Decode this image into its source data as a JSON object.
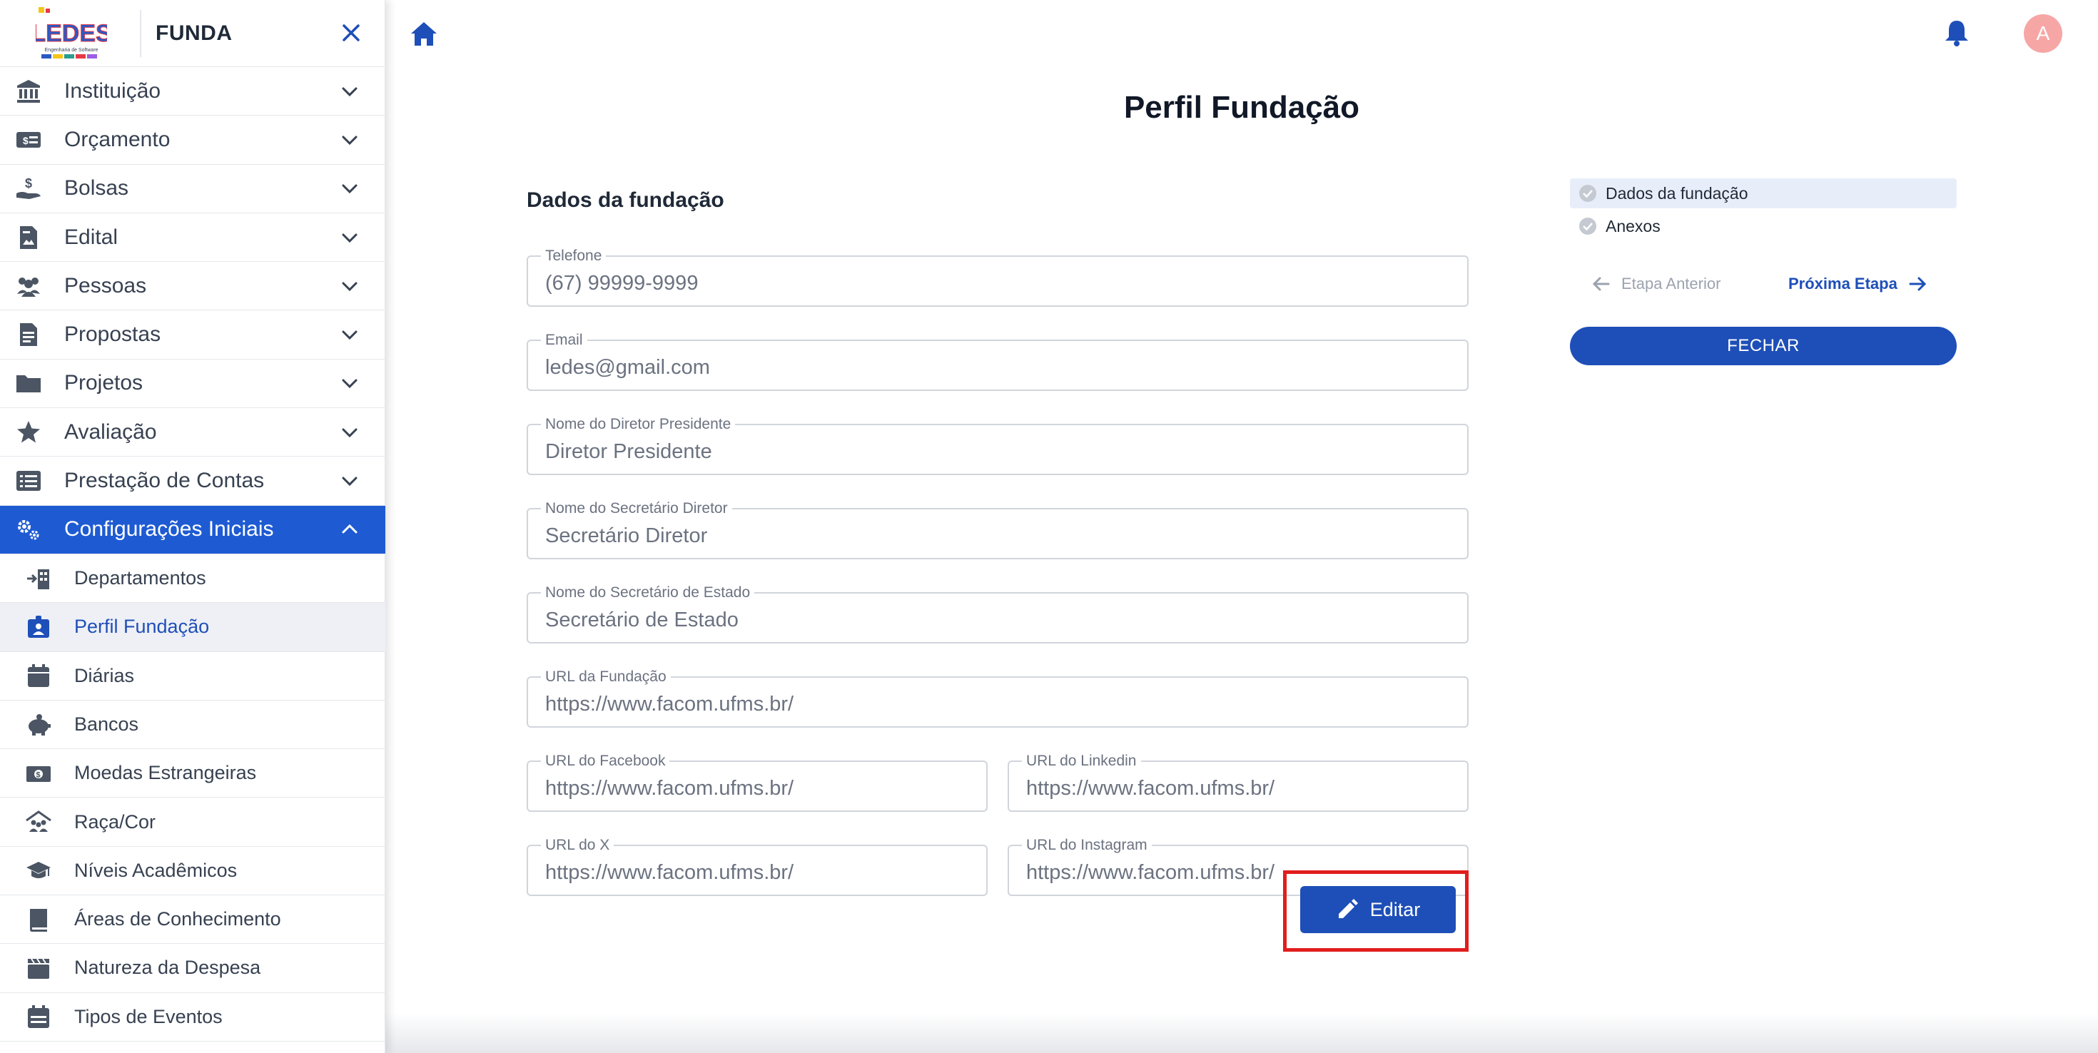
{
  "app": {
    "name": "FUNDA",
    "logo_text": "LEDES",
    "logo_subtext": "Engenharia de Software"
  },
  "sidebar": {
    "items": [
      {
        "label": "Instituição",
        "icon": "bank-icon"
      },
      {
        "label": "Orçamento",
        "icon": "money-icon"
      },
      {
        "label": "Bolsas",
        "icon": "hand-coin-icon"
      },
      {
        "label": "Edital",
        "icon": "document-image-icon"
      },
      {
        "label": "Pessoas",
        "icon": "people-icon"
      },
      {
        "label": "Propostas",
        "icon": "file-list-icon"
      },
      {
        "label": "Projetos",
        "icon": "folder-icon"
      },
      {
        "label": "Avaliação",
        "icon": "star-icon"
      },
      {
        "label": "Prestação de Contas",
        "icon": "list-icon"
      },
      {
        "label": "Configurações Iniciais",
        "icon": "gears-icon",
        "active": true
      }
    ],
    "subitems": [
      {
        "label": "Departamentos",
        "icon": "building-arrow-icon"
      },
      {
        "label": "Perfil Fundação",
        "icon": "id-badge-icon",
        "selected": true
      },
      {
        "label": "Diárias",
        "icon": "calendar-icon"
      },
      {
        "label": "Bancos",
        "icon": "piggy-bank-icon"
      },
      {
        "label": "Moedas Estrangeiras",
        "icon": "banknote-icon"
      },
      {
        "label": "Raça/Cor",
        "icon": "people-roof-icon"
      },
      {
        "label": "Níveis Acadêmicos",
        "icon": "graduation-cap-icon"
      },
      {
        "label": "Áreas de Conhecimento",
        "icon": "book-icon"
      },
      {
        "label": "Natureza da Despesa",
        "icon": "clapperboard-icon"
      },
      {
        "label": "Tipos de Eventos",
        "icon": "calendar-event-icon"
      }
    ]
  },
  "header": {
    "avatar_initial": "A"
  },
  "page": {
    "title": "Perfil Fundação",
    "section_title": "Dados da fundação"
  },
  "form": {
    "telefone": {
      "label": "Telefone",
      "value": "(67) 99999-9999"
    },
    "email": {
      "label": "Email",
      "value": "ledes@gmail.com"
    },
    "diretor": {
      "label": "Nome do Diretor Presidente",
      "value": "Diretor Presidente"
    },
    "secretario_diretor": {
      "label": "Nome do Secretário Diretor",
      "value": "Secretário Diretor"
    },
    "secretario_estado": {
      "label": "Nome do Secretário de Estado",
      "value": "Secretário de Estado"
    },
    "url_fundacao": {
      "label": "URL da Fundação",
      "value": "https://www.facom.ufms.br/"
    },
    "url_facebook": {
      "label": "URL do Facebook",
      "value": "https://www.facom.ufms.br/"
    },
    "url_linkedin": {
      "label": "URL do Linkedin",
      "value": "https://www.facom.ufms.br/"
    },
    "url_x": {
      "label": "URL do X",
      "value": "https://www.facom.ufms.br/"
    },
    "url_instagram": {
      "label": "URL do Instagram",
      "value": "https://www.facom.ufms.br/"
    },
    "edit_label": "Editar"
  },
  "stepper": {
    "steps": [
      "Dados da fundação",
      "Anexos"
    ],
    "prev_label": "Etapa Anterior",
    "next_label": "Próxima Etapa",
    "close_label": "FECHAR"
  },
  "colors": {
    "primary": "#1e4fb8",
    "sidebar_active": "#1e5bd3",
    "highlight": "#e11d1d",
    "avatar": "#f7a6a6"
  }
}
